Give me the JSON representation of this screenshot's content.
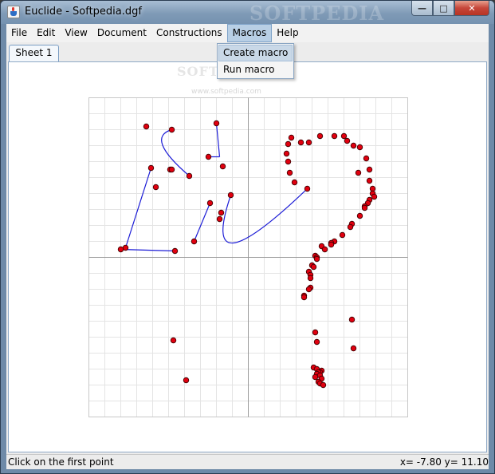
{
  "window": {
    "title": "Euclide - Softpedia.dgf",
    "watermark": "SOFTPEDIA",
    "controls": {
      "minimize": "—",
      "maximize": "□",
      "close": "✕"
    }
  },
  "menubar": [
    "File",
    "Edit",
    "View",
    "Document",
    "Constructions",
    "Macros",
    "Help"
  ],
  "active_menu": "Macros",
  "macros_menu": {
    "items": [
      "Create macro",
      "Run macro"
    ],
    "highlighted": "Create macro"
  },
  "menu_watermark": {
    "big": "SOFTPEDIA",
    "small": "www.softpedia.com"
  },
  "tabs": [
    "Sheet 1"
  ],
  "status": {
    "message": "Click on the first point",
    "coords": "x= -7.80 y= 11.10"
  },
  "colors": {
    "point_fill": "#e0000f",
    "point_stroke": "#3a0000",
    "curve": "#1c1cd6",
    "grid": "#e4e4e4",
    "axis": "#9a9a9a"
  },
  "canvas": {
    "xlim": [
      -20,
      20
    ],
    "ylim": [
      -20,
      20
    ],
    "grid_step": 2,
    "points": [
      [
        -12.8,
        16.4
      ],
      [
        -9.6,
        16.0
      ],
      [
        -4.0,
        16.8
      ],
      [
        -12.2,
        11.2
      ],
      [
        -9.8,
        11.0
      ],
      [
        -9.6,
        11.0
      ],
      [
        -7.4,
        10.2
      ],
      [
        -5.0,
        12.6
      ],
      [
        -3.2,
        11.4
      ],
      [
        -11.6,
        8.8
      ],
      [
        -2.2,
        7.8
      ],
      [
        -4.8,
        6.8
      ],
      [
        -3.4,
        5.6
      ],
      [
        -3.6,
        4.8
      ],
      [
        -6.8,
        2.0
      ],
      [
        -15.4,
        1.2
      ],
      [
        -16.0,
        1.0
      ],
      [
        -9.2,
        0.8
      ],
      [
        -9.4,
        -10.4
      ],
      [
        -7.8,
        -15.4
      ],
      [
        5.0,
        14.2
      ],
      [
        5.4,
        15.0
      ],
      [
        6.6,
        14.4
      ],
      [
        7.6,
        14.4
      ],
      [
        9.0,
        15.2
      ],
      [
        10.8,
        15.2
      ],
      [
        12.0,
        15.2
      ],
      [
        12.4,
        14.6
      ],
      [
        13.2,
        14.0
      ],
      [
        14.0,
        13.8
      ],
      [
        4.8,
        13.0
      ],
      [
        5.0,
        12.0
      ],
      [
        5.2,
        10.6
      ],
      [
        14.8,
        12.4
      ],
      [
        15.2,
        11.0
      ],
      [
        13.8,
        10.6
      ],
      [
        15.2,
        9.6
      ],
      [
        15.6,
        8.6
      ],
      [
        15.6,
        8.0
      ],
      [
        15.8,
        7.6
      ],
      [
        5.8,
        9.4
      ],
      [
        7.4,
        8.6
      ],
      [
        15.2,
        7.2
      ],
      [
        15.0,
        6.8
      ],
      [
        14.6,
        6.4
      ],
      [
        14.6,
        6.2
      ],
      [
        14.0,
        5.2
      ],
      [
        13.0,
        4.2
      ],
      [
        12.8,
        3.8
      ],
      [
        11.8,
        2.8
      ],
      [
        10.8,
        2.0
      ],
      [
        10.4,
        1.8
      ],
      [
        10.4,
        1.6
      ],
      [
        9.2,
        1.4
      ],
      [
        9.6,
        1.0
      ],
      [
        8.4,
        0.2
      ],
      [
        8.6,
        0.0
      ],
      [
        8.6,
        -0.2
      ],
      [
        8.0,
        -1.0
      ],
      [
        8.2,
        -1.2
      ],
      [
        7.6,
        -1.8
      ],
      [
        7.8,
        -2.2
      ],
      [
        7.8,
        -2.6
      ],
      [
        7.8,
        -3.8
      ],
      [
        7.6,
        -4.0
      ],
      [
        7.0,
        -4.8
      ],
      [
        7.0,
        -5.0
      ],
      [
        8.4,
        -9.4
      ],
      [
        8.6,
        -10.6
      ],
      [
        13.0,
        -7.8
      ],
      [
        13.2,
        -11.4
      ],
      [
        8.2,
        -13.8
      ],
      [
        8.6,
        -14.0
      ],
      [
        9.2,
        -14.2
      ],
      [
        9.0,
        -14.4
      ],
      [
        8.8,
        -14.4
      ],
      [
        8.6,
        -14.6
      ],
      [
        9.0,
        -14.8
      ],
      [
        8.4,
        -15.0
      ],
      [
        9.2,
        -15.2
      ],
      [
        8.8,
        -15.6
      ],
      [
        9.0,
        -15.8
      ],
      [
        9.4,
        -16.0
      ]
    ],
    "segments": [
      [
        [
          -15.4,
          1.2
        ],
        [
          -12.2,
          11.2
        ]
      ],
      [
        [
          -16.0,
          1.0
        ],
        [
          -9.2,
          0.8
        ]
      ],
      [
        [
          -6.8,
          2.0
        ],
        [
          -4.8,
          6.8
        ]
      ],
      [
        [
          -4.0,
          16.8
        ],
        [
          -3.6,
          12.6
        ]
      ],
      [
        [
          -3.6,
          12.6
        ],
        [
          -5.0,
          12.6
        ]
      ]
    ],
    "curves": [
      {
        "from": [
          -9.6,
          16.0
        ],
        "via": [
          -13.0,
          15.0
        ],
        "to": [
          -7.4,
          10.2
        ]
      },
      {
        "from": [
          -2.2,
          7.8
        ],
        "via": [
          -6.4,
          -4.6
        ],
        "to": [
          7.4,
          8.6
        ]
      }
    ]
  }
}
